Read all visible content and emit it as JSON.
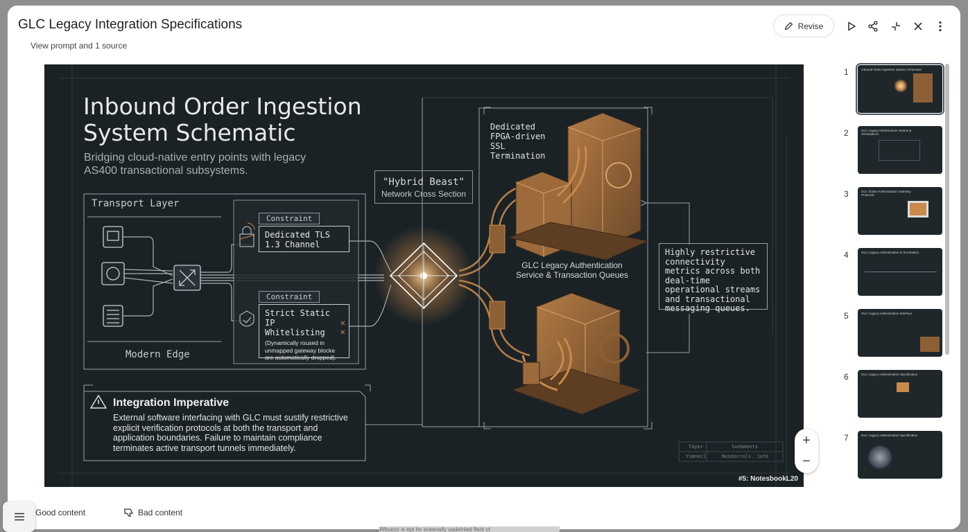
{
  "header": {
    "title": "GLC Legacy Integration Specifications",
    "prompt_link": "View prompt and 1 source",
    "revise_label": "Revise"
  },
  "slide": {
    "title": "Inbound Order Ingestion System Schematic",
    "subtitle": "Bridging cloud-native entry points with legacy AS400 transactional subsystems.",
    "transport_layer": "Transport Layer",
    "modern_edge": "Modern Edge",
    "constraint1_tag": "Constraint",
    "constraint1_text": "Dedicated TLS 1.3 Channel",
    "constraint2_tag": "Constraint",
    "constraint2_text": "Strict Static IP Whitelisting",
    "constraint2_note": "(Dynamically roused in unmapped gateway blocke are automatically dropped).",
    "hybrid_title": "\"Hybrid Beast\"",
    "hybrid_sub": "Network Cross Section",
    "fpga": "Dedicated FPGA-driven SSL Termination",
    "glc_service": "GLC Legacy Authentication Service & Transaction Queues",
    "restrictive": "Highly restrictive connectivity metrics across both deal-time operational streams and transactional messaging queues.",
    "imperative_title": "Integration Imperative",
    "imperative_body": "External software interfacing with GLC must sustify restrictive explicit verification protocols at both the transport and application boundaries. Failure to maintain compliance terminates active transport tunnels immediately.",
    "table_h1": "Tayer",
    "table_h2": "Svebments",
    "table_r1": "Ysmnecl",
    "table_r2": "Nondocrols. 1afe",
    "footer": "#5: NotesbookL20"
  },
  "zoom": {
    "plus": "+",
    "minus": "−"
  },
  "thumbnails": [
    {
      "num": "1",
      "title": "Inbound Order Ingestion System Schematic"
    },
    {
      "num": "2",
      "title": "GLC Legacy Infrastructure Seams & Terminations"
    },
    {
      "num": "3",
      "title": "GLC Scalar Authentication Gateway Protocols"
    },
    {
      "num": "4",
      "title": "GLC Legacy Authentication & Termination"
    },
    {
      "num": "5",
      "title": "GLC Legacy Authentication Interface"
    },
    {
      "num": "6",
      "title": "GLC Legacy Authentication Specification"
    },
    {
      "num": "7",
      "title": "GLC Legacy Authentication Specification"
    }
  ],
  "feedback": {
    "good": "Good content",
    "bad": "Bad content"
  },
  "peek_text": "Wbuezs is ept he sceenally uadeinled flerk ct",
  "colors": {
    "slide_bg": "#1b2226",
    "accent": "#c98a4a",
    "line": "#9aa3a8"
  }
}
